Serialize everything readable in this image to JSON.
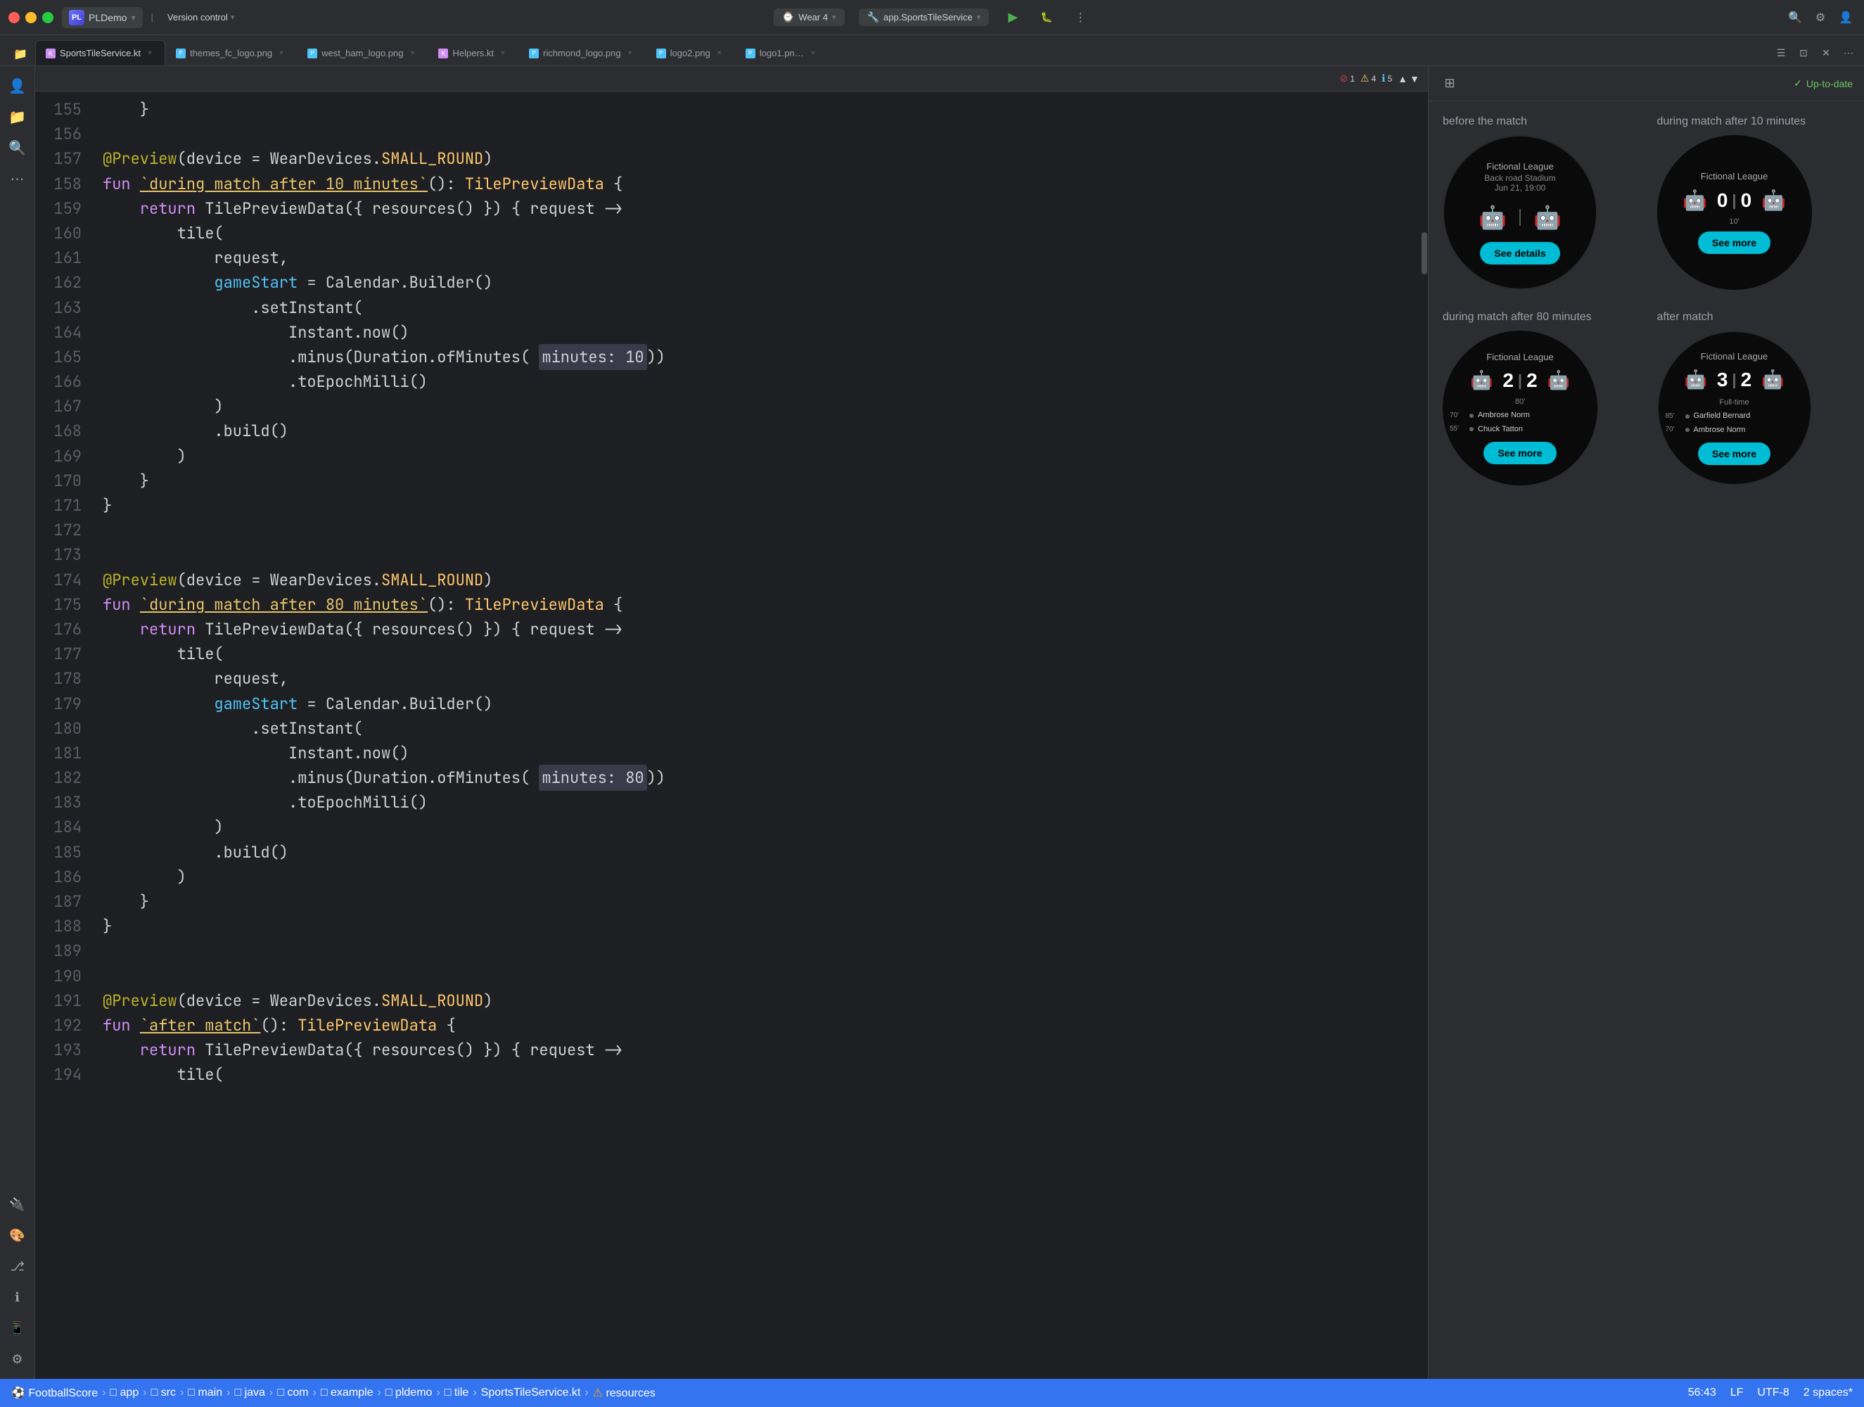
{
  "titlebar": {
    "traffic_lights": [
      "red",
      "yellow",
      "green"
    ],
    "app_label": "PL",
    "app_name": "PLDemo",
    "version_control": "Version control",
    "wear_label": "Wear 4",
    "service_label": "app.SportsTileService",
    "run_icon": "▶",
    "debug_icon": "🐛"
  },
  "tabs": [
    {
      "label": "SportsTileService.kt",
      "type": "kt",
      "active": true,
      "closeable": true
    },
    {
      "label": "themes_fc_logo.png",
      "type": "png",
      "active": false,
      "closeable": true
    },
    {
      "label": "west_ham_logo.png",
      "type": "png",
      "active": false,
      "closeable": true
    },
    {
      "label": "Helpers.kt",
      "type": "kt",
      "active": false,
      "closeable": true
    },
    {
      "label": "richmond_logo.png",
      "type": "png",
      "active": false,
      "closeable": true
    },
    {
      "label": "logo2.png",
      "type": "png",
      "active": false,
      "closeable": true
    },
    {
      "label": "logo1.pn…",
      "type": "png",
      "active": false,
      "closeable": true
    }
  ],
  "editor": {
    "warnings": {
      "error_count": 1,
      "warning_count": 4,
      "info_count": 5
    },
    "lines": [
      {
        "num": 155,
        "content": "    }",
        "tokens": [
          {
            "text": "    }",
            "class": "kw-white"
          }
        ]
      },
      {
        "num": 156,
        "content": "",
        "tokens": []
      },
      {
        "num": 157,
        "content": "@Preview(device = WearDevices.SMALL_ROUND)",
        "tokens": [
          {
            "text": "@Preview",
            "class": "annotation"
          },
          {
            "text": "(device = WearDevices.",
            "class": "kw-white"
          },
          {
            "text": "SMALL_ROUND",
            "class": "kw-orange"
          },
          {
            "text": ")",
            "class": "kw-white"
          }
        ]
      },
      {
        "num": 158,
        "content": "fun `during match after 10 minutes`(): TilePreviewData {",
        "tokens": [
          {
            "text": "fun ",
            "class": "kw-purple"
          },
          {
            "text": "`during match after 10 minutes`",
            "class": "kw-yellow"
          },
          {
            "text": "(): ",
            "class": "kw-white"
          },
          {
            "text": "TilePreviewData",
            "class": "kw-orange"
          },
          {
            "text": " {",
            "class": "kw-white"
          }
        ]
      },
      {
        "num": 159,
        "content": "    return TilePreviewData({ resources() }) { request ->",
        "tokens": [
          {
            "text": "    ",
            "class": "kw-white"
          },
          {
            "text": "return",
            "class": "kw-purple"
          },
          {
            "text": " TilePreviewData({ resources() }) { request ->",
            "class": "kw-white"
          }
        ]
      },
      {
        "num": 160,
        "content": "        tile(",
        "tokens": [
          {
            "text": "        tile(",
            "class": "kw-white"
          }
        ]
      },
      {
        "num": 161,
        "content": "            request,",
        "tokens": [
          {
            "text": "            request,",
            "class": "kw-white"
          }
        ]
      },
      {
        "num": 162,
        "content": "            gameStart = Calendar.Builder()",
        "tokens": [
          {
            "text": "            ",
            "class": "kw-white"
          },
          {
            "text": "gameStart",
            "class": "kw-blue"
          },
          {
            "text": " = Calendar.Builder()",
            "class": "kw-white"
          }
        ]
      },
      {
        "num": 163,
        "content": "                .setInstant(",
        "tokens": [
          {
            "text": "                .setInstant(",
            "class": "kw-white"
          }
        ]
      },
      {
        "num": 164,
        "content": "                    Instant.now()",
        "tokens": [
          {
            "text": "                    Instant.now()",
            "class": "kw-white"
          }
        ]
      },
      {
        "num": 165,
        "content": "                    .minus(Duration.ofMinutes( minutes: 10))",
        "tokens": [
          {
            "text": "                    .minus(Duration.ofMinutes( ",
            "class": "kw-white"
          },
          {
            "text": "minutes: 10",
            "class": "highlight-param"
          },
          {
            "text": "))",
            "class": "kw-white"
          }
        ]
      },
      {
        "num": 166,
        "content": "                    .toEpochMilli()",
        "tokens": [
          {
            "text": "                    .toEpochMilli()",
            "class": "kw-white"
          }
        ]
      },
      {
        "num": 167,
        "content": "            )",
        "tokens": [
          {
            "text": "            )",
            "class": "kw-white"
          }
        ]
      },
      {
        "num": 168,
        "content": "            .build()",
        "tokens": [
          {
            "text": "            .build()",
            "class": "kw-white"
          }
        ]
      },
      {
        "num": 169,
        "content": "        )",
        "tokens": [
          {
            "text": "        )",
            "class": "kw-white"
          }
        ]
      },
      {
        "num": 170,
        "content": "    }",
        "tokens": [
          {
            "text": "    }",
            "class": "kw-white"
          }
        ]
      },
      {
        "num": 171,
        "content": "}",
        "tokens": [
          {
            "text": "}",
            "class": "kw-white"
          }
        ]
      },
      {
        "num": 172,
        "content": "",
        "tokens": []
      },
      {
        "num": 173,
        "content": "",
        "tokens": []
      },
      {
        "num": 174,
        "content": "@Preview(device = WearDevices.SMALL_ROUND)",
        "tokens": [
          {
            "text": "@Preview",
            "class": "annotation"
          },
          {
            "text": "(device = WearDevices.",
            "class": "kw-white"
          },
          {
            "text": "SMALL_ROUND",
            "class": "kw-orange"
          },
          {
            "text": ")",
            "class": "kw-white"
          }
        ]
      },
      {
        "num": 175,
        "content": "fun `during match after 80 minutes`(): TilePreviewData {",
        "tokens": [
          {
            "text": "fun ",
            "class": "kw-purple"
          },
          {
            "text": "`during match after 80 minutes`",
            "class": "kw-yellow"
          },
          {
            "text": "(): ",
            "class": "kw-white"
          },
          {
            "text": "TilePreviewData",
            "class": "kw-orange"
          },
          {
            "text": " {",
            "class": "kw-white"
          }
        ]
      },
      {
        "num": 176,
        "content": "    return TilePreviewData({ resources() }) { request ->",
        "tokens": [
          {
            "text": "    ",
            "class": "kw-white"
          },
          {
            "text": "return",
            "class": "kw-purple"
          },
          {
            "text": " TilePreviewData({ resources() }) { request ->",
            "class": "kw-white"
          }
        ]
      },
      {
        "num": 177,
        "content": "        tile(",
        "tokens": [
          {
            "text": "        tile(",
            "class": "kw-white"
          }
        ]
      },
      {
        "num": 178,
        "content": "            request,",
        "tokens": [
          {
            "text": "            request,",
            "class": "kw-white"
          }
        ]
      },
      {
        "num": 179,
        "content": "            gameStart = Calendar.Builder()",
        "tokens": [
          {
            "text": "            ",
            "class": "kw-white"
          },
          {
            "text": "gameStart",
            "class": "kw-blue"
          },
          {
            "text": " = Calendar.Builder()",
            "class": "kw-white"
          }
        ]
      },
      {
        "num": 180,
        "content": "                .setInstant(",
        "tokens": [
          {
            "text": "                .setInstant(",
            "class": "kw-white"
          }
        ]
      },
      {
        "num": 181,
        "content": "                    Instant.now()",
        "tokens": [
          {
            "text": "                    Instant.now()",
            "class": "kw-white"
          }
        ]
      },
      {
        "num": 182,
        "content": "                    .minus(Duration.ofMinutes( minutes: 80))",
        "tokens": [
          {
            "text": "                    .minus(Duration.ofMinutes( ",
            "class": "kw-white"
          },
          {
            "text": "minutes: 80",
            "class": "highlight-param"
          },
          {
            "text": "))",
            "class": "kw-white"
          }
        ]
      },
      {
        "num": 183,
        "content": "                    .toEpochMilli()",
        "tokens": [
          {
            "text": "                    .toEpochMilli()",
            "class": "kw-white"
          }
        ]
      },
      {
        "num": 184,
        "content": "            )",
        "tokens": [
          {
            "text": "            )",
            "class": "kw-white"
          }
        ]
      },
      {
        "num": 185,
        "content": "            .build()",
        "tokens": [
          {
            "text": "            .build()",
            "class": "kw-white"
          }
        ]
      },
      {
        "num": 186,
        "content": "        )",
        "tokens": [
          {
            "text": "        )",
            "class": "kw-white"
          }
        ]
      },
      {
        "num": 187,
        "content": "    }",
        "tokens": [
          {
            "text": "    }",
            "class": "kw-white"
          }
        ]
      },
      {
        "num": 188,
        "content": "}",
        "tokens": [
          {
            "text": "}",
            "class": "kw-white"
          }
        ]
      },
      {
        "num": 189,
        "content": "",
        "tokens": []
      },
      {
        "num": 190,
        "content": "",
        "tokens": []
      },
      {
        "num": 191,
        "content": "@Preview(device = WearDevices.SMALL_ROUND)",
        "tokens": [
          {
            "text": "@Preview",
            "class": "annotation"
          },
          {
            "text": "(device = WearDevices.",
            "class": "kw-white"
          },
          {
            "text": "SMALL_ROUND",
            "class": "kw-orange"
          },
          {
            "text": ")",
            "class": "kw-white"
          }
        ]
      },
      {
        "num": 192,
        "content": "fun `after match`(): TilePreviewData {",
        "tokens": [
          {
            "text": "fun ",
            "class": "kw-purple"
          },
          {
            "text": "`after match`",
            "class": "kw-yellow"
          },
          {
            "text": "(): ",
            "class": "kw-white"
          },
          {
            "text": "TilePreviewData",
            "class": "kw-orange"
          },
          {
            "text": " {",
            "class": "kw-white"
          }
        ]
      },
      {
        "num": 193,
        "content": "    return TilePreviewData({ resources() }) { request ->",
        "tokens": [
          {
            "text": "    ",
            "class": "kw-white"
          },
          {
            "text": "return",
            "class": "kw-purple"
          },
          {
            "text": " TilePreviewData({ resources() }) { request ->",
            "class": "kw-white"
          }
        ]
      },
      {
        "num": 194,
        "content": "        tile(",
        "tokens": [
          {
            "text": "        tile(",
            "class": "kw-white"
          }
        ]
      }
    ]
  },
  "preview": {
    "up_to_date": "Up-to-date",
    "panels": [
      {
        "id": "before-match",
        "label": "before the match",
        "type": "before",
        "league": "Fictional League",
        "stadium": "Back road Stadium",
        "date": "Jun 21, 19:00",
        "button_label": "See details"
      },
      {
        "id": "during-10min",
        "label": "during match after 10 minutes",
        "type": "during-10",
        "league": "Fictional League",
        "score_home": "0",
        "score_away": "0",
        "minute": "10'",
        "button_label": "See more"
      },
      {
        "id": "during-80min",
        "label": "during match after 80 minutes",
        "type": "during-80",
        "league": "Fictional League",
        "score_home": "2",
        "score_away": "2",
        "minute": "80'",
        "scorers": [
          {
            "time": "70'",
            "name": "Ambrose Norm"
          },
          {
            "time": "55'",
            "name": "Chuck Tatton"
          }
        ],
        "button_label": "See more"
      },
      {
        "id": "after-match",
        "label": "after match",
        "type": "after",
        "league": "Fictional League",
        "score_home": "3",
        "score_away": "2",
        "fulltime": "Full-time",
        "scorers": [
          {
            "time": "85'",
            "name": "Garfield Bernard"
          },
          {
            "time": "70'",
            "name": "Ambrose Norm"
          }
        ],
        "button_label": "See more"
      }
    ]
  },
  "statusbar": {
    "breadcrumb": [
      "FootballScore",
      "app",
      "src",
      "main",
      "java",
      "com",
      "example",
      "pldemo",
      "tile",
      "SportsTileService.kt",
      "resources"
    ],
    "position": "56:43",
    "encoding": "LF",
    "charset": "UTF-8",
    "indent": "2 spaces*"
  }
}
